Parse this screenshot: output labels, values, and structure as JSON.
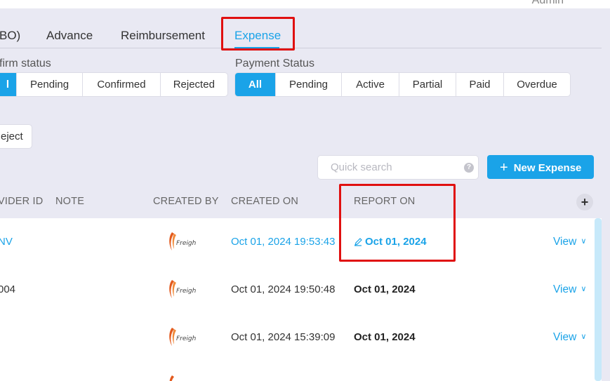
{
  "header": {
    "user_label": "Admin"
  },
  "tabs": [
    {
      "label": "BO)"
    },
    {
      "label": "Advance"
    },
    {
      "label": "Reimbursement"
    },
    {
      "label": "Expense",
      "active": true
    }
  ],
  "confirm_status": {
    "label": "firm status",
    "options": [
      "l",
      "Pending",
      "Confirmed",
      "Rejected"
    ],
    "selected": "l"
  },
  "payment_status": {
    "label": "Payment Status",
    "options": [
      "All",
      "Pending",
      "Active",
      "Partial",
      "Paid",
      "Overdue"
    ],
    "selected": "All"
  },
  "actions": {
    "reject_label": "eject"
  },
  "search": {
    "placeholder": "Quick search",
    "value": "",
    "help_icon": "question-icon"
  },
  "new_button": {
    "label": "New Expense",
    "icon": "plus-icon"
  },
  "table": {
    "columns": [
      "VIDER ID",
      "NOTE",
      "CREATED BY",
      "CREATED ON",
      "REPORT ON"
    ],
    "add_column_icon": "plus-icon",
    "rows": [
      {
        "provider_id": "NV",
        "note": "",
        "created_by": "Freight logo",
        "created_on": "Oct 01, 2024 19:53:43",
        "report_on": "Oct 01, 2024",
        "editable": true,
        "action": "View"
      },
      {
        "provider_id": "004",
        "note": "",
        "created_by": "Freight logo",
        "created_on": "Oct 01, 2024 19:50:48",
        "report_on": "Oct 01, 2024",
        "editable": false,
        "action": "View"
      },
      {
        "provider_id": "",
        "note": "",
        "created_by": "Freight logo",
        "created_on": "Oct 01, 2024 15:39:09",
        "report_on": "Oct 01, 2024",
        "editable": false,
        "action": "View"
      }
    ]
  },
  "colors": {
    "accent": "#1aa3e8",
    "highlight": "#e01010",
    "background": "#e9e9f3"
  }
}
